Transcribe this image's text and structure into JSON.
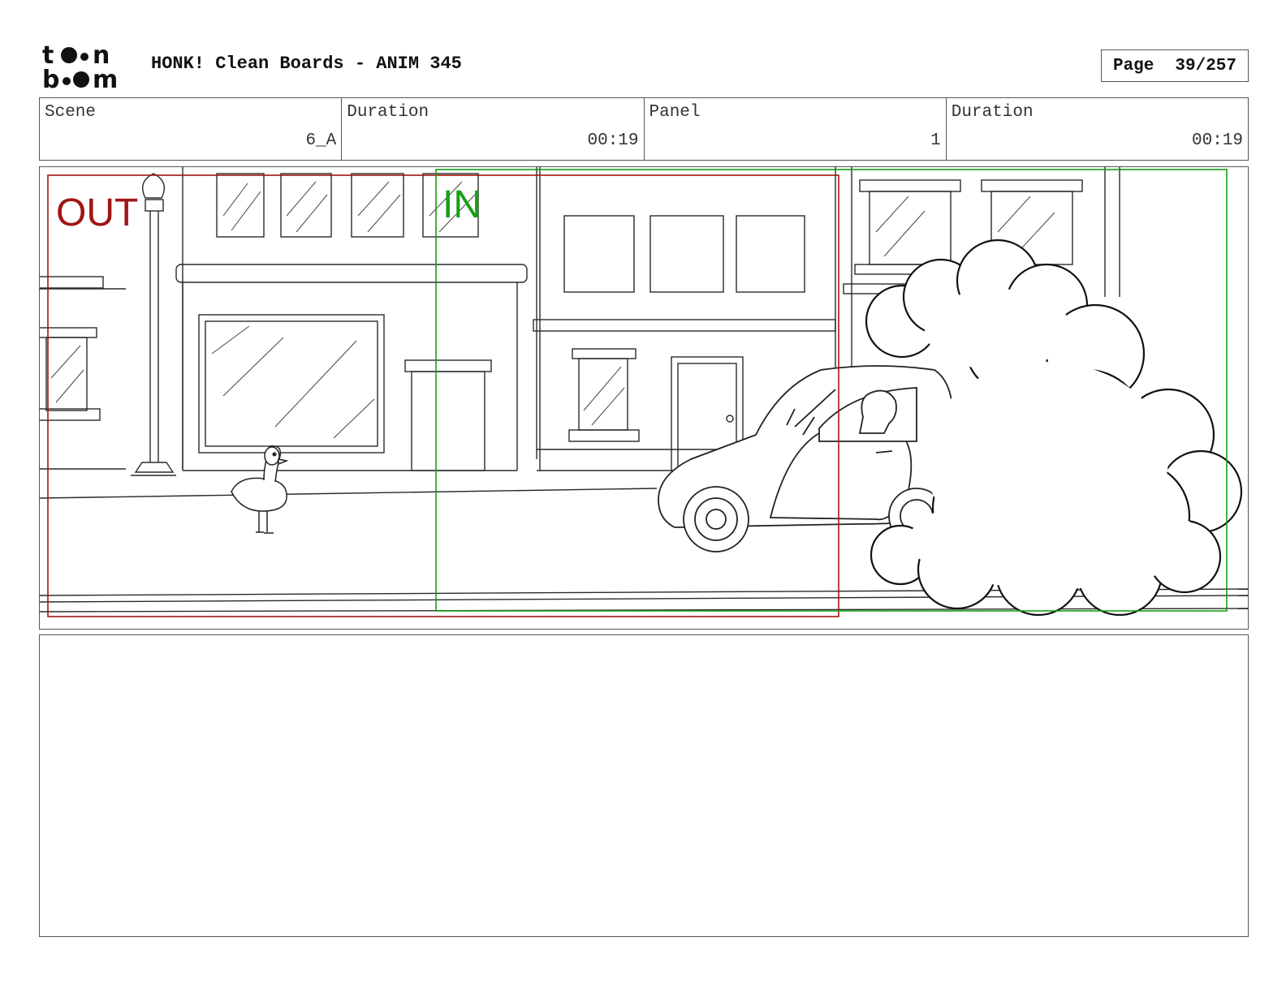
{
  "header": {
    "logo_top": "t●●n",
    "logo_bottom": "b●●m",
    "title": "HONK! Clean Boards - ANIM 345",
    "page_label": "Page",
    "page_value": "39/257"
  },
  "info": {
    "scene_label": "Scene",
    "scene_value": "6_A",
    "scene_duration_label": "Duration",
    "scene_duration_value": "00:19",
    "panel_label": "Panel",
    "panel_value": "1",
    "panel_duration_label": "Duration",
    "panel_duration_value": "00:19"
  },
  "panel": {
    "out_label": "OUT",
    "in_label": "IN",
    "colors": {
      "out": "#a01515",
      "in": "#14a014",
      "ink": "#222222"
    }
  },
  "notes": {
    "text": ""
  }
}
